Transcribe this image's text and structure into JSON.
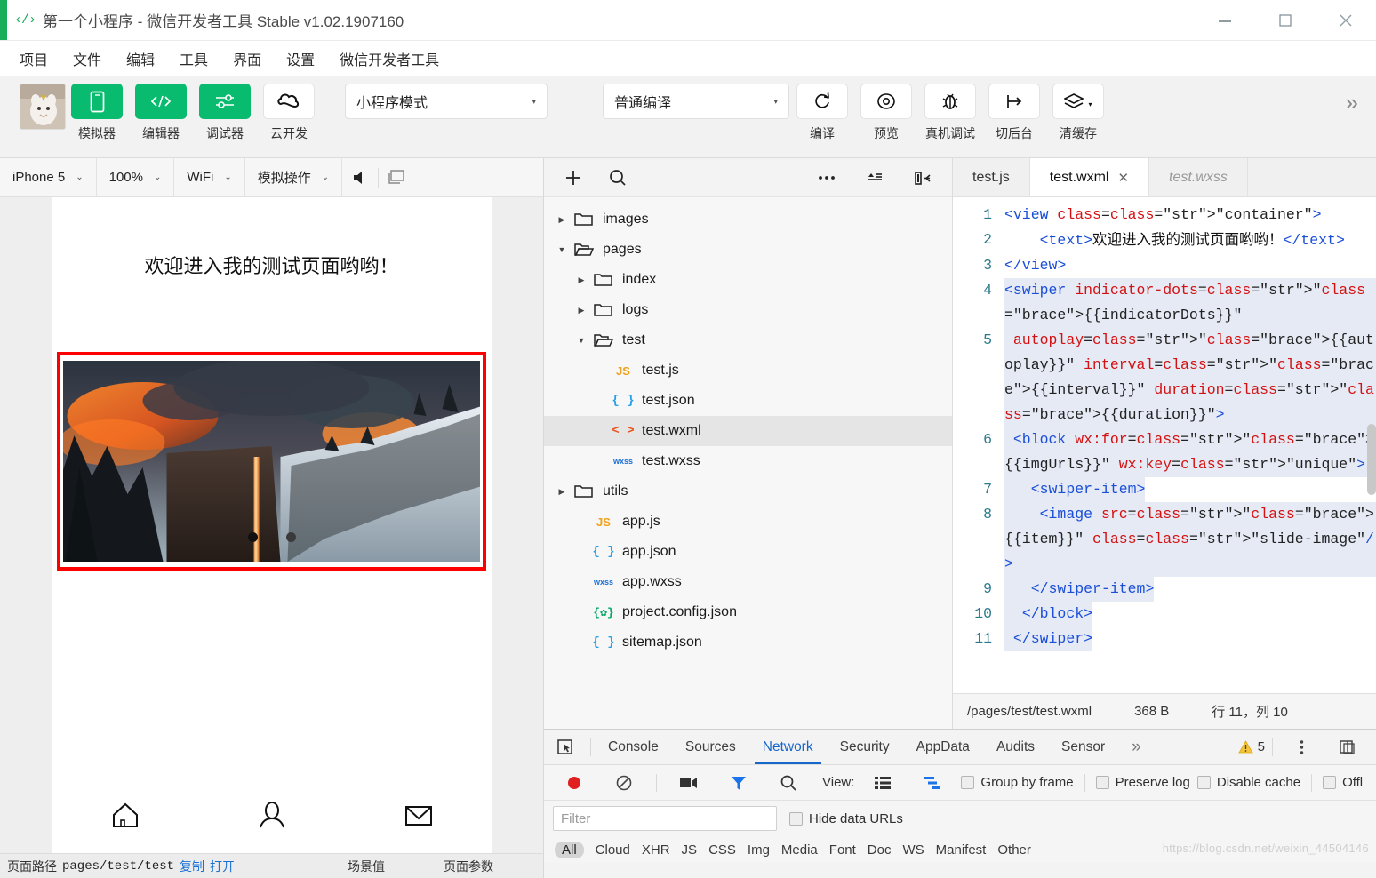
{
  "titlebar": {
    "icon": "code-icon",
    "title": "第一个小程序 - 微信开发者工具 Stable v1.02.1907160",
    "minimize": "minimize-icon",
    "maximize": "maximize-icon",
    "close": "close-icon"
  },
  "menubar": {
    "items": [
      "项目",
      "文件",
      "编辑",
      "工具",
      "界面",
      "设置",
      "微信开发者工具"
    ]
  },
  "toolbar": {
    "avatar_alt": "user-avatar",
    "buttons": [
      {
        "label": "模拟器",
        "icon": "phone-icon",
        "style": "green"
      },
      {
        "label": "编辑器",
        "icon": "code-brackets-icon",
        "style": "green"
      },
      {
        "label": "调试器",
        "icon": "sliders-icon",
        "style": "green"
      },
      {
        "label": "云开发",
        "icon": "cloud-dev-icon",
        "style": "white"
      }
    ],
    "mode_select": {
      "value": "小程序模式",
      "caret": "▾"
    },
    "compile_select": {
      "value": "普通编译",
      "caret": "▾"
    },
    "actions": [
      {
        "label": "编译",
        "icon": "refresh-icon"
      },
      {
        "label": "预览",
        "icon": "eye-icon"
      },
      {
        "label": "真机调试",
        "icon": "bug-icon"
      },
      {
        "label": "切后台",
        "icon": "background-icon"
      },
      {
        "label": "清缓存",
        "icon": "layers-icon",
        "has_caret": true
      }
    ],
    "overflow": "»"
  },
  "simulator": {
    "device": "iPhone 5",
    "zoom": "100%",
    "network": "WiFi",
    "gesture": "模拟操作",
    "caret": "⌄",
    "volume_icon": "speaker-icon",
    "screenshot_icon": "screen-icon",
    "page": {
      "welcome_text": "欢迎进入我的测试页面哟哟！",
      "swiper_border_color": "#ff0000",
      "dots": [
        "active",
        "dim"
      ],
      "tabbar": [
        "home-icon",
        "person-icon",
        "mail-icon"
      ]
    },
    "footer": {
      "path_label": "页面路径",
      "path_value": "pages/test/test",
      "copy": "复制",
      "open": "打开",
      "scene_label": "场景值",
      "params_label": "页面参数"
    }
  },
  "explorer": {
    "toolbar": [
      "plus-icon",
      "search-icon",
      "more-icon",
      "collapse-icon",
      "panel-toggle-icon"
    ],
    "tree": [
      {
        "name": "images",
        "type": "folder",
        "depth": 0,
        "expanded": false
      },
      {
        "name": "pages",
        "type": "folder",
        "depth": 0,
        "expanded": true
      },
      {
        "name": "index",
        "type": "folder",
        "depth": 1,
        "expanded": false
      },
      {
        "name": "logs",
        "type": "folder",
        "depth": 1,
        "expanded": false
      },
      {
        "name": "test",
        "type": "folder",
        "depth": 1,
        "expanded": true
      },
      {
        "name": "test.js",
        "type": "js",
        "depth": 2,
        "badge": "JS"
      },
      {
        "name": "test.json",
        "type": "json",
        "depth": 2,
        "badge": "{ }"
      },
      {
        "name": "test.wxml",
        "type": "wxml",
        "depth": 2,
        "badge": "< >",
        "selected": true
      },
      {
        "name": "test.wxss",
        "type": "wxss",
        "depth": 2,
        "badge": "wxss"
      },
      {
        "name": "utils",
        "type": "folder",
        "depth": 0,
        "expanded": false
      },
      {
        "name": "app.js",
        "type": "js",
        "depth": 1,
        "badge": "JS"
      },
      {
        "name": "app.json",
        "type": "json",
        "depth": 1,
        "badge": "{ }"
      },
      {
        "name": "app.wxss",
        "type": "wxss",
        "depth": 1,
        "badge": "wxss"
      },
      {
        "name": "project.config.json",
        "type": "config",
        "depth": 1,
        "badge": "{✿}"
      },
      {
        "name": "sitemap.json",
        "type": "json",
        "depth": 1,
        "badge": "{ }"
      }
    ]
  },
  "editor": {
    "tabs": [
      {
        "label": "test.js",
        "active": false,
        "closable": false,
        "ghost": false
      },
      {
        "label": "test.wxml",
        "active": true,
        "closable": true,
        "close_glyph": "✕",
        "ghost": false
      },
      {
        "label": "test.wxss",
        "active": false,
        "closable": false,
        "ghost": true
      }
    ],
    "lines": [
      {
        "n": "1",
        "text": "<view class=\"container\">"
      },
      {
        "n": "2",
        "text": "    <text>欢迎进入我的测试页面哟哟！</text>"
      },
      {
        "n": "3",
        "text": "</view>"
      },
      {
        "n": "4",
        "text": "<swiper indicator-dots=\"{{indicatorDots}}\""
      },
      {
        "n": "5",
        "text": " autoplay=\"{{autoplay}}\" interval=\"{{interval}}\" duration=\"{{duration}}\">"
      },
      {
        "n": "6",
        "text": " <block wx:for=\"{{imgUrls}}\" wx:key=\"unique\">"
      },
      {
        "n": "7",
        "text": "   <swiper-item>"
      },
      {
        "n": "8",
        "text": "    <image src=\"{{item}}\" class=\"slide-image\"/>"
      },
      {
        "n": "9",
        "text": "   </swiper-item>"
      },
      {
        "n": "10",
        "text": "  </block>"
      },
      {
        "n": "11",
        "text": " </swiper>"
      }
    ],
    "status": {
      "file_path": "/pages/test/test.wxml",
      "size": "368 B",
      "cursor": "行 11，列 10"
    }
  },
  "devtools": {
    "inspect_icon": "inspect-icon",
    "tabs": [
      "Console",
      "Sources",
      "Network",
      "Security",
      "AppData",
      "Audits",
      "Sensor"
    ],
    "active_tab": "Network",
    "overflow": "»",
    "warning_icon": "warning-icon",
    "warning_count": "5",
    "menu_icon": "kebab-menu-icon",
    "dock_icon": "dock-icon",
    "network_toolbar": {
      "record_icon": "record-icon",
      "clear_icon": "clear-icon",
      "capture_icon": "camera-icon",
      "filter_icon": "funnel-icon",
      "search_icon": "search-icon",
      "view_label": "View:",
      "view_list_icon": "list-view-icon",
      "view_waterfall_icon": "waterfall-view-icon",
      "checkboxes": [
        "Group by frame",
        "Preserve log",
        "Disable cache",
        "Offl"
      ]
    },
    "filter_row": {
      "placeholder": "Filter",
      "value": "",
      "hide_data_urls": "Hide data URLs"
    },
    "filter_types": [
      "All",
      "Cloud",
      "XHR",
      "JS",
      "CSS",
      "Img",
      "Media",
      "Font",
      "Doc",
      "WS",
      "Manifest",
      "Other"
    ],
    "active_filter_type": "All"
  },
  "watermark": "https://blog.csdn.net/weixin_44504146"
}
